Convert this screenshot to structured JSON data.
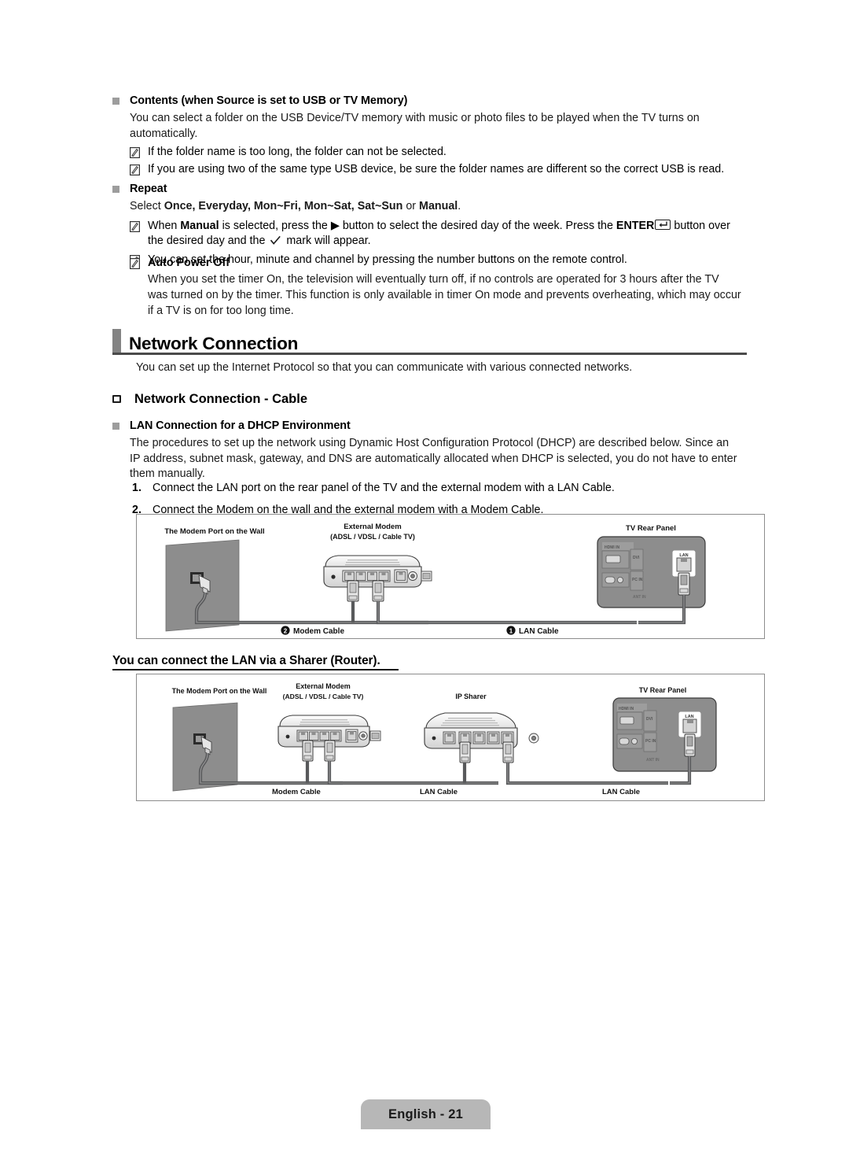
{
  "page": {
    "footer_label": "English - 21",
    "language": "English",
    "page_number": "21"
  },
  "sections": {
    "contents": {
      "heading": "Contents (when Source is set to USB or TV Memory)",
      "paragraph": "You can select a folder on the USB Device/TV memory with music or photo files to be played when the TV turns on automatically.",
      "notes": [
        "If the folder name is too long, the folder can not be selected.",
        "If you are using two of the same type USB device, be sure the folder names are different so the correct USB is read."
      ]
    },
    "repeat": {
      "heading": "Repeat",
      "select_line_prefix": "Select ",
      "select_line_bold": "Once, Everyday, Mon~Fri, Mon~Sat, Sat~Sun",
      "select_line_mid": " or ",
      "select_line_bold2": "Manual",
      "select_line_suffix": ".",
      "note1_a": "When ",
      "note1_bold": "Manual",
      "note1_b": " is selected, press the ",
      "note1_arrow": "▶",
      "note1_c": " button to select the desired day of the week. Press the ",
      "note1_enter": "ENTER",
      "note1_d": " button over the desired day and the ",
      "note1_e": " mark will appear.",
      "note2": "You can set the hour, minute and channel by pressing the number buttons on the remote control."
    },
    "auto_power_off": {
      "heading": "Auto Power Off",
      "paragraph": "When you set the timer On, the television will eventually turn off, if no controls are operated for 3 hours after the TV was turned on by the timer. This function is only available in timer On mode and prevents overheating, which may occur if a TV is on for too long time."
    },
    "network_connection": {
      "title": "Network Connection",
      "intro": "You can set up the Internet Protocol so that you can communicate with various connected networks.",
      "subheading_cable": "Network Connection - Cable",
      "dhcp_heading": "LAN Connection for a DHCP Environment",
      "dhcp_paragraph": "The procedures to set up the network using Dynamic Host Configuration Protocol (DHCP) are described below. Since an IP address, subnet mask, gateway, and DNS are automatically allocated when DHCP is selected, you do not have to enter them manually.",
      "steps": [
        {
          "num": "1.",
          "text": "Connect the LAN port on the rear panel of the TV and the external modem with a LAN Cable."
        },
        {
          "num": "2.",
          "text": "Connect the Modem on the wall and the external modem with a Modem Cable."
        }
      ],
      "sharer_heading": "You can connect the LAN via a Sharer (Router)."
    }
  },
  "diagram_cable": {
    "labels": {
      "wall": "The Modem Port on the Wall",
      "modem_title": "External Modem",
      "modem_sub": "(ADSL / VDSL / Cable TV)",
      "tv": "TV Rear Panel",
      "modem_cable": "Modem Cable",
      "modem_cable_num": "2",
      "lan_cable": "LAN Cable",
      "lan_cable_num": "1",
      "port_lan": "LAN",
      "port_hdmi": "HDMI IN",
      "port_dvi": "DVI",
      "port_pcin": "PC IN",
      "port_antin": "ANT IN"
    }
  },
  "diagram_sharer": {
    "labels": {
      "wall": "The Modem Port on the Wall",
      "modem_title": "External Modem",
      "modem_sub": "(ADSL / VDSL / Cable TV)",
      "sharer": "IP Sharer",
      "tv": "TV Rear Panel",
      "modem_cable": "Modem Cable",
      "lan_cable_1": "LAN Cable",
      "lan_cable_2": "LAN Cable",
      "port_lan": "LAN",
      "port_hdmi": "HDMI IN",
      "port_dvi": "DVI",
      "port_pcin": "PC IN",
      "port_antin": "ANT IN"
    }
  },
  "colors": {
    "bullet_grey": "#9d9d9d",
    "heading_bar": "#838383",
    "rule": "#4a4a4a",
    "diagram_border": "#8c8c8c",
    "device_grey": "#8d8d8d",
    "footer_badge": "#b7b7b7",
    "cable": "#58595b"
  }
}
